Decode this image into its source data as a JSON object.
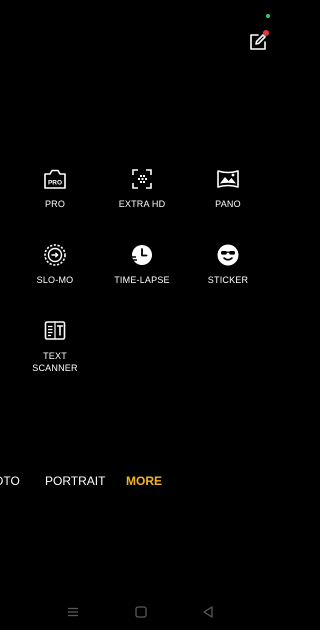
{
  "status": {
    "indicator_color": "#2ecc71"
  },
  "top_bar": {
    "edit_icon": "edit-icon",
    "badge_color": "#e53935"
  },
  "modes": [
    {
      "label": "PRO",
      "icon": "pro-camera-icon"
    },
    {
      "label": "EXTRA HD",
      "icon": "extra-hd-icon"
    },
    {
      "label": "PANO",
      "icon": "panorama-icon"
    },
    {
      "label": "SLO-MO",
      "icon": "slow-motion-icon"
    },
    {
      "label": "TIME-LAPSE",
      "icon": "time-lapse-icon"
    },
    {
      "label": "STICKER",
      "icon": "sticker-icon"
    },
    {
      "label": "TEXT\nSCANNER",
      "icon": "text-scanner-icon"
    }
  ],
  "tabs": [
    {
      "label": "OTO",
      "active": false
    },
    {
      "label": "PORTRAIT",
      "active": false
    },
    {
      "label": "MORE",
      "active": true
    }
  ],
  "accent_color": "#f5b324",
  "nav": {
    "menu_icon": "menu-icon",
    "home_icon": "home-icon",
    "back_icon": "back-icon"
  }
}
